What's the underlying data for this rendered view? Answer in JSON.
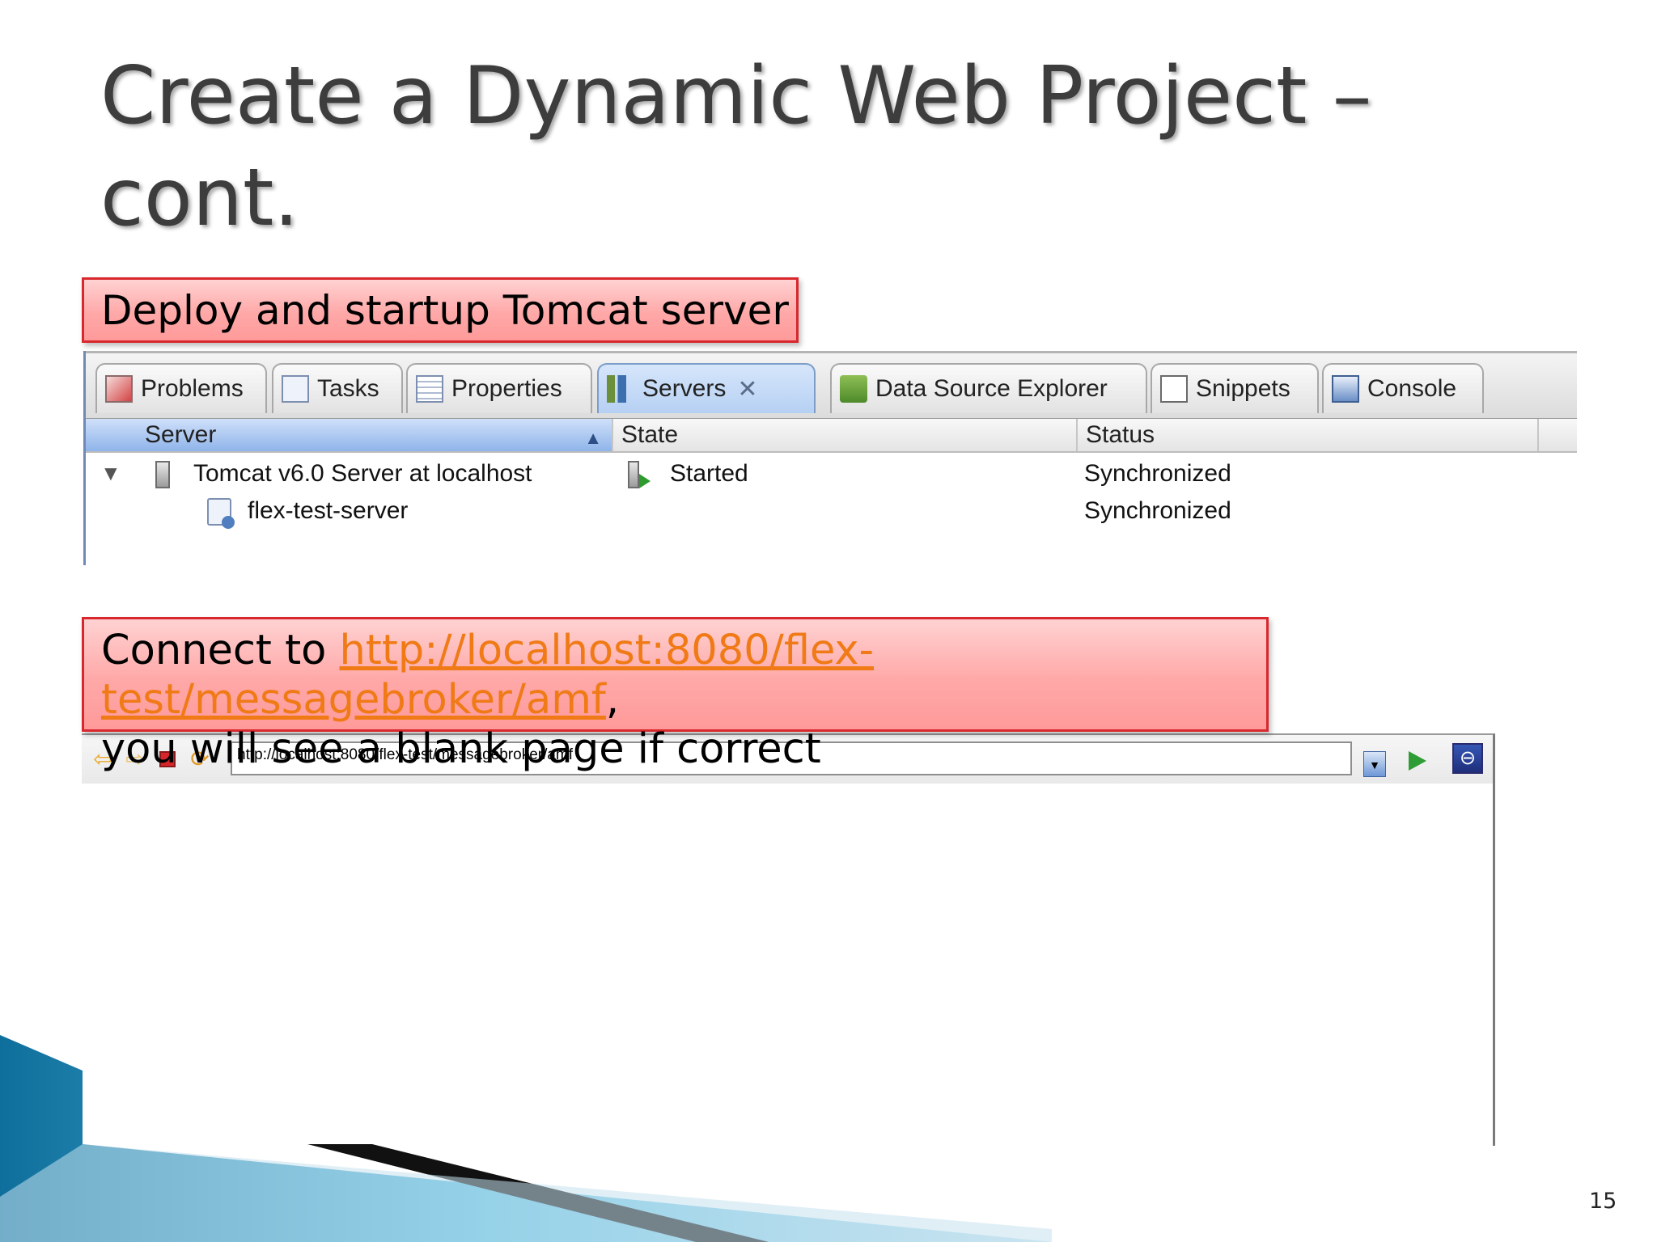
{
  "slide": {
    "title_line1": "Create a Dynamic Web Project –",
    "title_line2": "cont.",
    "callout_deploy": "Deploy and startup Tomcat server",
    "callout_connect_prefix": "Connect to ",
    "callout_connect_link": "http://localhost:8080/flex-test/messagebroker/amf",
    "callout_connect_suffix": ",",
    "callout_connect_line2": " you will see a blank page if correct",
    "page_number": "15"
  },
  "eclipse": {
    "tabs": [
      {
        "label": "Problems",
        "icon": "problems-icon"
      },
      {
        "label": "Tasks",
        "icon": "tasks-icon"
      },
      {
        "label": "Properties",
        "icon": "properties-icon"
      },
      {
        "label": "Servers",
        "icon": "servers-icon",
        "active": true,
        "close_glyph": "✕"
      },
      {
        "label": "Data Source Explorer",
        "icon": "data-source-icon"
      },
      {
        "label": "Snippets",
        "icon": "snippets-icon"
      },
      {
        "label": "Console",
        "icon": "console-icon"
      }
    ],
    "columns": [
      "Server",
      "State",
      "Status"
    ],
    "sort_glyph": "▲",
    "rows": [
      {
        "server": "Tomcat v6.0 Server at localhost",
        "state": "Started",
        "status": "Synchronized",
        "expand_glyph": "▼"
      },
      {
        "server": "flex-test-server",
        "state": "",
        "status": "Synchronized"
      }
    ]
  },
  "browser": {
    "url": "http://localhost:8080/flex-test/messagebroker/amf",
    "back_glyph": "⇦",
    "forward_glyph": "⇨",
    "refresh_glyph": "⟳",
    "dropdown_glyph": "▼",
    "eclipse_glyph": "⊖"
  },
  "colors": {
    "callout_border": "#d8282d",
    "link": "#f07a15",
    "title_text": "#3d3d3d",
    "swoosh_blue": "#1e8bb8"
  }
}
